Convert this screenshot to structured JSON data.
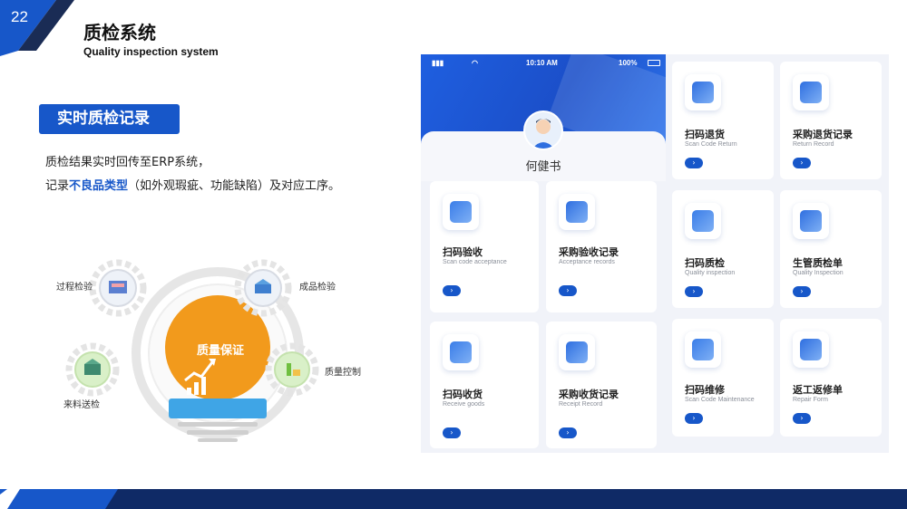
{
  "page": {
    "number": "22",
    "title_cn": "质检系统",
    "title_en": "Quality inspection system"
  },
  "section": {
    "badge": "实时质检记录",
    "line1": "质检结果实时回传至ERP系统，",
    "line2_prefix": "记录",
    "line2_highlight": "不良品类型",
    "line2_suffix": "（如外观瑕疵、功能缺陷）及对应工序。"
  },
  "diagram": {
    "center": "质量保证",
    "nodes": {
      "process_inspection": "过程检验",
      "finished_inspection": "成品检验",
      "quality_control": "质量控制",
      "incoming_inspection": "来料送检"
    }
  },
  "phone": {
    "status": {
      "time": "10:10 AM",
      "battery": "100%"
    },
    "user_name": "何健书",
    "arrow": "›",
    "cards": [
      {
        "cn": "扫码验收",
        "en": "Scan code acceptance",
        "icon": "box-icon"
      },
      {
        "cn": "采购验收记录",
        "en": "Acceptance records",
        "icon": "chat-list-icon"
      },
      {
        "cn": "扫码收货",
        "en": "Receive goods",
        "icon": "download-box-icon"
      },
      {
        "cn": "采购收货记录",
        "en": "Receipt Record",
        "icon": "edit-doc-icon"
      },
      {
        "cn": "扫码退货",
        "en": "Scan Code Return",
        "icon": "return-box-icon"
      },
      {
        "cn": "采购退货记录",
        "en": "Return Record",
        "icon": "search-doc-icon"
      },
      {
        "cn": "扫码质检",
        "en": "Quality inspection",
        "icon": "shield-check-icon"
      },
      {
        "cn": "生管质检单",
        "en": "Quality Inspection",
        "icon": "form-icon"
      },
      {
        "cn": "扫码维修",
        "en": "Scan Code Maintenance",
        "icon": "grid-scan-icon"
      },
      {
        "cn": "返工返修单",
        "en": "Repair Form",
        "icon": "wrench-doc-icon"
      }
    ]
  },
  "colors": {
    "primary": "#1757c9",
    "navy": "#0f2a66",
    "bulb_orange": "#f29a1c"
  }
}
